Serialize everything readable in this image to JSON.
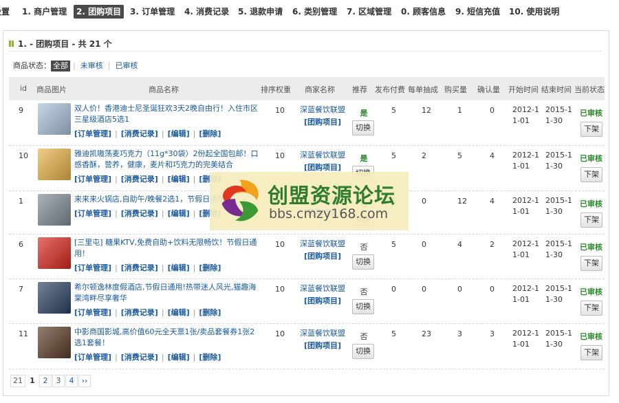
{
  "nav": {
    "items": [
      {
        "label": "设置"
      },
      {
        "label": "1. 商户管理"
      },
      {
        "label": "2. 团购项目"
      },
      {
        "label": "3. 订单管理"
      },
      {
        "label": "4. 消费记录"
      },
      {
        "label": "5. 退款申请"
      },
      {
        "label": "6. 类别管理"
      },
      {
        "label": "7. 区域管理"
      },
      {
        "label": "0. 顾客信息"
      },
      {
        "label": "9. 短信充值"
      },
      {
        "label": "10. 使用说明"
      }
    ],
    "active_index": 2
  },
  "panel": {
    "title": "1. - 团购项目 - 共 21 个"
  },
  "filter": {
    "label": "商品状态：",
    "options": [
      {
        "label": "全部",
        "active": true
      },
      {
        "label": "未审核",
        "active": false
      },
      {
        "label": "已审核",
        "active": false
      }
    ]
  },
  "table": {
    "headers": [
      "id",
      "商品图片",
      "商品名称",
      "排序权重",
      "商家名称",
      "推荐",
      "发布付费",
      "每单抽成",
      "购买量",
      "确认量",
      "开始时间",
      "结束时间",
      "当前状态"
    ],
    "action_labels": [
      "[订单管理]",
      "[消费记录]",
      "[编辑]",
      "[删除]"
    ],
    "rows": [
      {
        "id": "9",
        "name": "双人价！香港迪士尼圣诞狂欢3天2晚自由行！入住市区三星级酒店5选1",
        "weight": "10",
        "merchant": "深蓝餐饮联盟",
        "merchant_link": "[团购项目]",
        "recommend": "是",
        "recommended": true,
        "toggle": "切换",
        "fee": "5",
        "commission": "12",
        "bought": "1",
        "confirmed": "0",
        "start": "2012-11-01",
        "end": "2015-11-30",
        "status": "已审核",
        "offline": "下架",
        "thumb_color": "#a7c0d8"
      },
      {
        "id": "10",
        "name": "雅迪凯嗷荡麦巧克力（11g*30袋）2份起全国包邮！口感香酥，营养，健康，麦片和巧克力的完美结合",
        "weight": "10",
        "merchant": "深蓝餐饮联盟",
        "merchant_link": "[团购项目]",
        "recommend": "是",
        "recommended": true,
        "toggle": "切换",
        "fee": "5",
        "commission": "2",
        "bought": "5",
        "confirmed": "4",
        "start": "2012-11-01",
        "end": "2015-11-30",
        "status": "已审核",
        "offline": "下架",
        "thumb_color": "#e7b146"
      },
      {
        "id": "1",
        "name": "来来来火锅店,自助午/晚餐2选1，节假日通用",
        "weight": "10",
        "merchant": "深蓝餐饮联盟",
        "merchant_link": "[团购项目]",
        "recommend": "否",
        "recommended": false,
        "toggle": "切换",
        "fee": "5",
        "commission": "0",
        "bought": "12",
        "confirmed": "4",
        "start": "2012-11-01",
        "end": "2015-11-30",
        "status": "已审核",
        "offline": "下架",
        "thumb_color": "#7f8b93"
      },
      {
        "id": "6",
        "name": "[三里屯] 糖果KTV,免费自助+饮料无限畅饮！节假日通用！",
        "weight": "10",
        "merchant": "深蓝餐饮联盟",
        "merchant_link": "[团购项目]",
        "recommend": "否",
        "recommended": false,
        "toggle": "切换",
        "fee": "5",
        "commission": "0",
        "bought": "4",
        "confirmed": "2",
        "start": "2012-11-01",
        "end": "2015-11-30",
        "status": "已审核",
        "offline": "下架",
        "thumb_color": "#d7261c"
      },
      {
        "id": "7",
        "name": "希尔顿逸林度假酒店,节假日通用!热带迷人风光,猫趣海棠湾畔尽享奢华",
        "weight": "10",
        "merchant": "深蓝餐饮联盟",
        "merchant_link": "[团购项目]",
        "recommend": "否",
        "recommended": false,
        "toggle": "切换",
        "fee": "0",
        "commission": "0",
        "bought": "0",
        "confirmed": "0",
        "start": "2012-11-01",
        "end": "2015-11-30",
        "status": "已审核",
        "offline": "下架",
        "thumb_color": "#2c3f63"
      },
      {
        "id": "11",
        "name": "中影商国影城,高价值60元全天票1张/卖品套餐券1张2选1套餐！",
        "weight": "10",
        "merchant": "深蓝餐饮联盟",
        "merchant_link": "[团购项目]",
        "recommend": "否",
        "recommended": false,
        "toggle": "切换",
        "fee": "5",
        "commission": "23",
        "bought": "3",
        "confirmed": "3",
        "start": "2012-11-01",
        "end": "2015-11-30",
        "status": "已审核",
        "offline": "下架",
        "thumb_color": "#5a3a26"
      }
    ]
  },
  "pager": {
    "total": "21",
    "pages": [
      "1",
      "2",
      "3",
      "4"
    ],
    "current": "1",
    "next": "››"
  },
  "watermark": {
    "title": "创盟资源论坛",
    "url": "bbs.cmzy168.com"
  }
}
